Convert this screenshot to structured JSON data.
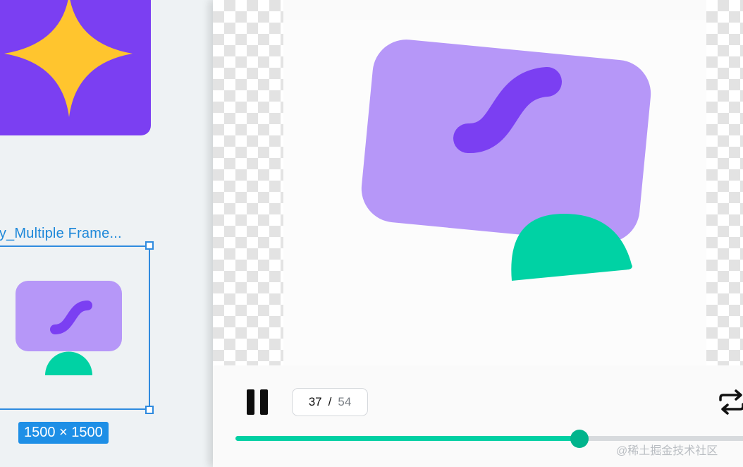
{
  "canvas": {
    "frame_label": "ry_Multiple Frame...",
    "size_badge": "1500 × 1500"
  },
  "player": {
    "current_frame": "37",
    "separator": "/",
    "total_frames": "54",
    "progress": 0.6685,
    "pause_icon": "pause-icon",
    "loop_icon": "loop-icon"
  },
  "colors": {
    "purple": "#7b3ff2",
    "lavender": "#b697f8",
    "star_yellow": "#ffc52e",
    "mint": "#00d2a4",
    "selection_blue": "#2f8bdf",
    "progress_fill": "#00d0a3",
    "progress_knob": "#00b48c"
  },
  "watermark": "@稀土掘金技术社区"
}
